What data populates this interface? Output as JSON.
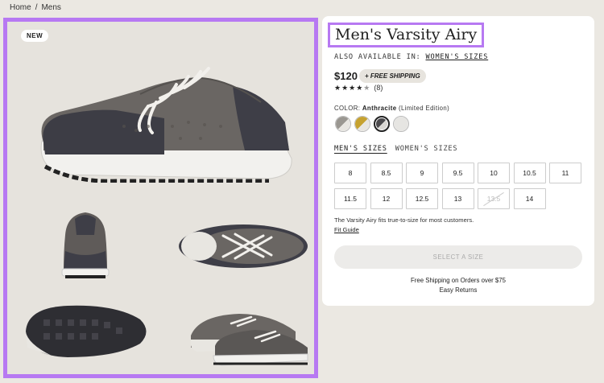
{
  "breadcrumb": {
    "items": [
      "Home",
      "Mens"
    ],
    "separator": "/"
  },
  "gallery": {
    "badge": "NEW"
  },
  "product": {
    "title": "Men's Varsity Airy",
    "also_available_label": "ALSO AVAILABLE IN:",
    "also_available_link": "WOMEN'S SIZES",
    "price": "$120",
    "shipping_badge": "+ FREE SHIPPING",
    "rating_stars": "★★★★",
    "rating_empty_star": "★",
    "review_count": "(8)",
    "color_label": "COLOR:",
    "color_name": "Anthracite",
    "color_note": "(Limited Edition)",
    "swatches": [
      {
        "name": "grey-white",
        "colors": [
          "#9a9791",
          "#e8e6e1"
        ]
      },
      {
        "name": "mustard",
        "colors": [
          "#c6a230",
          "#e8e6e1"
        ]
      },
      {
        "name": "anthracite",
        "colors": [
          "#4b4a4d",
          "#d9d7d3"
        ]
      },
      {
        "name": "white",
        "colors": [
          "#e6e5e2",
          "#ffffff"
        ]
      }
    ]
  },
  "sizes": {
    "tabs": [
      "MEN'S SIZES",
      "WOMEN'S SIZES"
    ],
    "values": [
      "8",
      "8.5",
      "9",
      "9.5",
      "10",
      "10.5",
      "11",
      "11.5",
      "12",
      "12.5",
      "13",
      "13.5",
      "14"
    ],
    "unavailable": [
      "13.5"
    ]
  },
  "fit": {
    "note": "The Varsity Airy fits true-to-size for most customers.",
    "guide_link": "Fit Guide"
  },
  "cta": {
    "select_label": "SELECT A SIZE"
  },
  "footer": {
    "free_shipping": "Free Shipping on Orders over $75",
    "returns": "Easy Returns"
  },
  "colors": {
    "accent": "#b779f2",
    "background": "#ebe8e2",
    "panel": "#ffffff"
  }
}
